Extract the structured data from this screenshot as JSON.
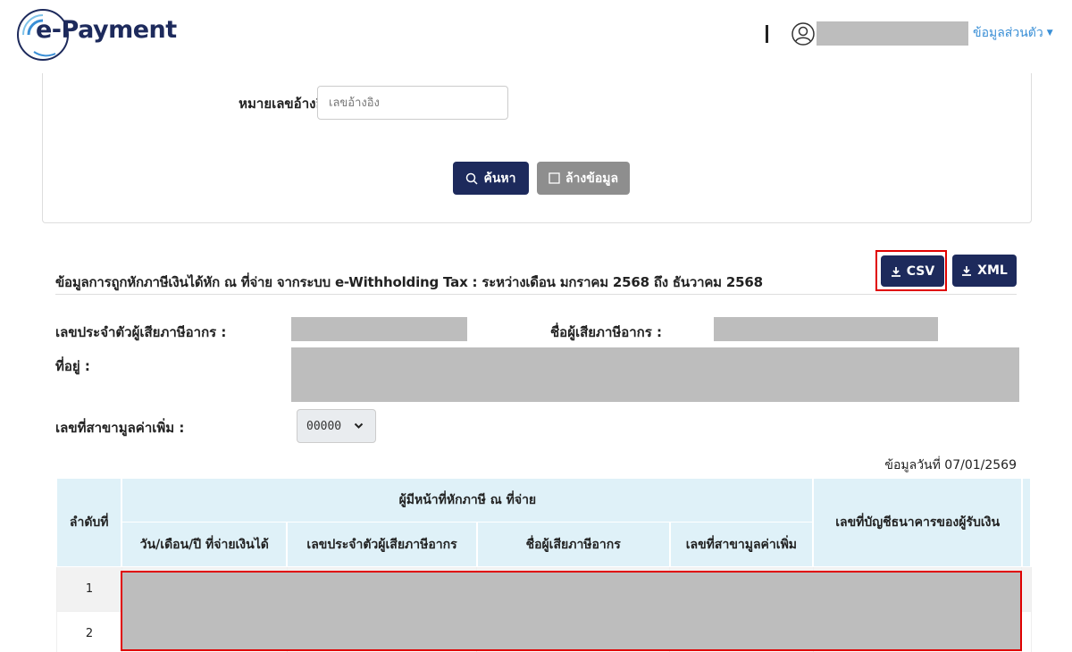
{
  "header": {
    "logo_text": "e-Payment",
    "profile_label": "ข้อมูลส่วนตัว"
  },
  "search": {
    "ref_label": "หมายเลขอ้างอิง :",
    "ref_placeholder": "เลขอ้างอิง",
    "search_button": "ค้นหา",
    "clear_button": "ล้างข้อมูล"
  },
  "section": {
    "title": "ข้อมูลการถูกหักภาษีเงินได้หัก ณ ที่จ่าย จากระบบ e-Withholding Tax : ระหว่างเดือน มกราคม 2568 ถึง ธันวาคม 2568",
    "csv_button": "CSV",
    "xml_button": "XML"
  },
  "taxpayer": {
    "tax_id_label": "เลขประจำตัวผู้เสียภาษีอากร :",
    "name_label": "ชื่อผู้เสียภาษีอากร :",
    "address_label": "ที่อยู่ :",
    "branch_label": "เลขที่สาขามูลค่าเพิ่ม :",
    "branch_value": "00000"
  },
  "data_date": "ข้อมูลวันที่ 07/01/2569",
  "table": {
    "col_index": "ลำดับที่",
    "group_header": "ผู้มีหน้าที่หักภาษี ณ ที่จ่าย",
    "col_date": "วัน/เดือน/ปี ที่จ่ายเงินได้",
    "col_tax_id": "เลขประจำตัวผู้เสียภาษีอากร",
    "col_name": "ชื่อผู้เสียภาษีอากร",
    "col_branch": "เลขที่สาขามูลค่าเพิ่ม",
    "col_bank": "เลขที่บัญชีธนาคารของผู้รับเงิน",
    "rows": [
      {
        "index": "1"
      },
      {
        "index": "2"
      }
    ]
  },
  "colors": {
    "navy": "#1d2a5c",
    "table_header": "#dff1f8",
    "highlight": "#e00000",
    "redaction": "#bdbdbd",
    "link": "#3a8fd6"
  }
}
